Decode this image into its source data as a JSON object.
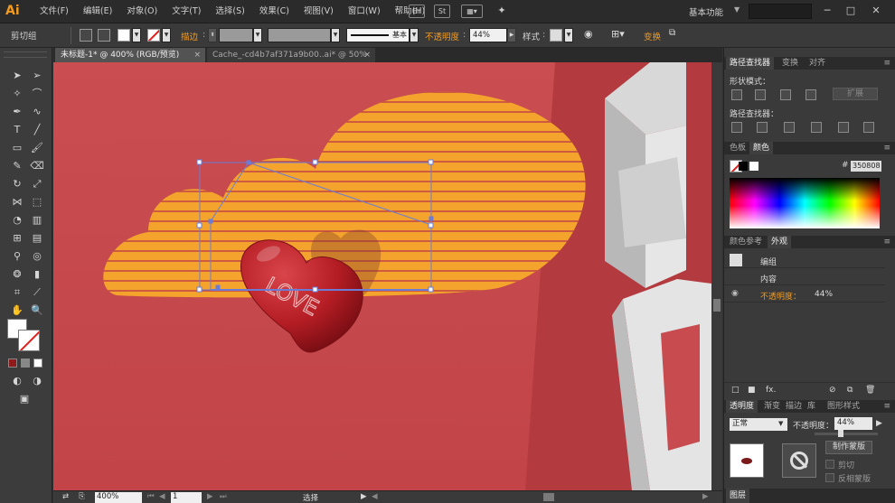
{
  "menubar": {
    "app_logo": "Ai",
    "items": [
      "文件(F)",
      "编辑(E)",
      "对象(O)",
      "文字(T)",
      "选择(S)",
      "效果(C)",
      "视图(V)",
      "窗口(W)",
      "帮助(H)"
    ],
    "workspace": "基本功能",
    "bridge_label": "Br",
    "stock_label": "St"
  },
  "controlbar": {
    "selection_type": "剪切组",
    "stroke_label": "描边",
    "stroke_style_label": "基本",
    "opacity_label": "不透明度",
    "opacity_value": "44%",
    "style_label": "样式",
    "transform_label": "变换"
  },
  "documents": {
    "tabs": [
      {
        "label": "未标题-1* @ 400% (RGB/预览)",
        "close": "×"
      },
      {
        "label": "Cache_-cd4b7af371a9b00..ai* @ 50% (RGB/预览)",
        "close": "×"
      }
    ]
  },
  "canvas": {
    "heart_text": "LOVE",
    "colors": {
      "background": "#c74b4f",
      "cloud": "#f4a42c",
      "stripe": "#c14344",
      "heart": "#b51d24",
      "selection": "#6b7cd6"
    }
  },
  "status": {
    "zoom": "400%",
    "page": "1",
    "tool": "选择"
  },
  "panels": {
    "pathfinder": {
      "tabs": [
        "路径查找器",
        "变换",
        "对齐"
      ],
      "shape_modes_label": "形状模式：",
      "expand_label": "扩展",
      "pathfinders_label": "路径查找器："
    },
    "color": {
      "tabs": [
        "色板",
        "颜色"
      ],
      "hex_value": "350808"
    },
    "appearance": {
      "tabs": [
        "颜色参考",
        "外观"
      ],
      "rows": [
        {
          "label": "编组",
          "value": ""
        },
        {
          "label": "内容",
          "value": ""
        },
        {
          "label": "不透明度：",
          "value": "44%"
        }
      ],
      "fx_label": "fx."
    },
    "transparency": {
      "tabs": [
        "透明度",
        "渐变",
        "描边",
        "库",
        "图形样式"
      ],
      "blend_mode": "正常",
      "opacity_label": "不透明度：",
      "opacity_value": "44%",
      "make_mask_label": "制作蒙版",
      "clip_label": "剪切",
      "invert_label": "反相蒙版"
    },
    "layers": {
      "tab": "图层"
    }
  },
  "icons": [
    "search-icon",
    "selection-tool-icon",
    "direct-selection-tool-icon",
    "pen-tool-icon",
    "type-tool-icon",
    "line-tool-icon",
    "rectangle-tool-icon",
    "brush-tool-icon",
    "rotate-tool-icon",
    "scale-tool-icon",
    "eyedropper-tool-icon",
    "blend-tool-icon",
    "graph-tool-icon",
    "artboard-tool-icon",
    "hand-tool-icon",
    "zoom-tool-icon",
    "visibility-eye-icon",
    "trash-icon",
    "new-item-icon",
    "panel-menu-icon"
  ]
}
